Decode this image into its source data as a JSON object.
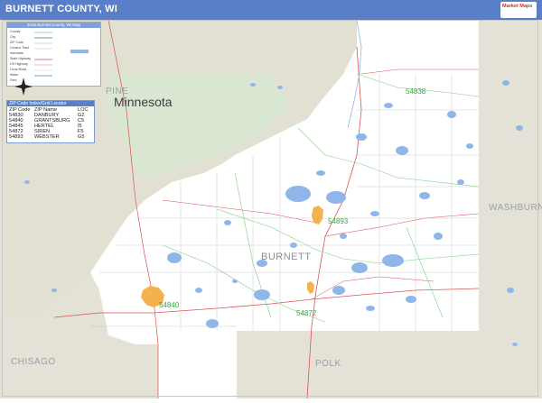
{
  "header": {
    "title": "BURNETT COUNTY, WI",
    "logo_text": "Market Maps"
  },
  "map": {
    "state_label": "Minnesota",
    "county_label": "BURNETT",
    "neighbors": {
      "pine": "PINE",
      "washburn": "WASHBURN",
      "chisago": "CHISAGO",
      "polk": "POLK"
    },
    "zip_labels": {
      "z54838": "54838",
      "z54893": "54893",
      "z54840": "54840",
      "z54872": "54872"
    },
    "colors": {
      "water": "#8fb6e8",
      "county_bg": "#ffffff",
      "outside": "#e2e0d4",
      "state_green": "#dde8d4",
      "road_red": "#d9534f",
      "zip_green": "#7fcf7f",
      "town_orange": "#f3b24e"
    }
  },
  "legend": {
    "title": "2016 Burnett County, WI Map",
    "rows": [
      "County",
      "City",
      "ZIP Code",
      "Census Tract",
      "Interstate",
      "State Highway",
      "US Highway",
      "Local Road",
      "Water",
      "Park"
    ]
  },
  "zip_index": {
    "title": "ZIP Code Index/Grid Locator",
    "headers": [
      "ZIP Code",
      "ZIP Name",
      "LOC"
    ],
    "rows": [
      [
        "54830",
        "DANBURY",
        "G2"
      ],
      [
        "54840",
        "GRANTSBURG",
        "C5"
      ],
      [
        "54845",
        "HERTEL",
        "I5"
      ],
      [
        "54872",
        "SIREN",
        "F5"
      ],
      [
        "54893",
        "WEBSTER",
        "G5"
      ]
    ]
  }
}
